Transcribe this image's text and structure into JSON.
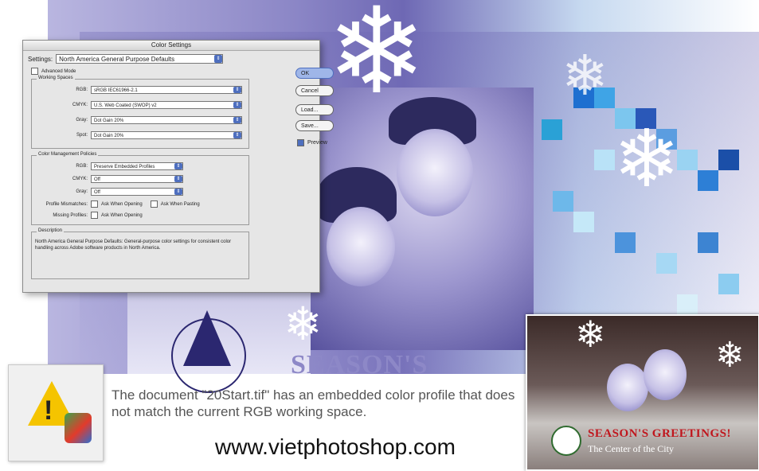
{
  "dialog": {
    "title": "Color Settings",
    "settings_label": "Settings:",
    "settings_value": "North America General Purpose Defaults",
    "advanced_mode": "Advanced Mode",
    "working_spaces": {
      "title": "Working Spaces",
      "rows": [
        {
          "label": "RGB:",
          "value": "sRGB IEC61966-2.1"
        },
        {
          "label": "CMYK:",
          "value": "U.S. Web Coated (SWOP) v2"
        },
        {
          "label": "Gray:",
          "value": "Dot Gain 20%"
        },
        {
          "label": "Spot:",
          "value": "Dot Gain 20%"
        }
      ]
    },
    "color_management": {
      "title": "Color Management Policies",
      "rows": [
        {
          "label": "RGB:",
          "value": "Preserve Embedded Profiles"
        },
        {
          "label": "CMYK:",
          "value": "Off"
        },
        {
          "label": "Gray:",
          "value": "Off"
        }
      ],
      "profile_mismatches_label": "Profile Mismatches:",
      "ask_when_opening": "Ask When Opening",
      "ask_when_pasting": "Ask When Pasting",
      "missing_profiles_label": "Missing Profiles:",
      "ask_when_opening_2": "Ask When Opening"
    },
    "description": {
      "title": "Description",
      "text": "North America General Purpose Defaults: General-purpose color settings for consistent color handling across Adobe software products in North America."
    },
    "buttons": {
      "ok": "OK",
      "cancel": "Cancel",
      "load": "Load...",
      "save": "Save...",
      "preview": "Preview"
    }
  },
  "warning_message": "The document \"20Start.tif\" has an embedded color profile that does not match the current RGB working space.",
  "website": "www.vietphotoshop.com",
  "card": {
    "greeting": "SEASON'S GREETINGS!",
    "subtitle": "The Center of the City"
  },
  "seasons_text": "SEASON'S",
  "colors": {
    "warning_yellow": "#f5c400",
    "select_arrow": "#4e6fbf",
    "greeting_red": "#c0161d"
  }
}
